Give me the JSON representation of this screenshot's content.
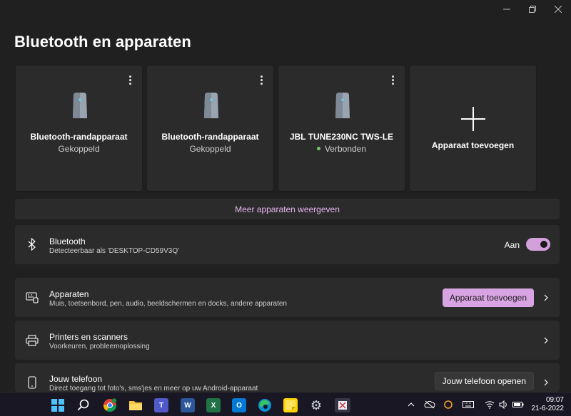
{
  "window": {
    "minimize": "—",
    "maximize": "❐",
    "close": "✕"
  },
  "page": {
    "title": "Bluetooth en apparaten"
  },
  "devices": [
    {
      "name": "Bluetooth-randapparaat",
      "status": "Gekoppeld",
      "icon": "bluetooth-device-icon"
    },
    {
      "name": "Bluetooth-randapparaat",
      "status": "Gekoppeld",
      "icon": "bluetooth-device-icon"
    },
    {
      "name": "JBL TUNE230NC TWS-LE",
      "status": "Verbonden",
      "icon": "bluetooth-device-icon"
    }
  ],
  "add_card": {
    "label": "Apparaat toevoegen"
  },
  "more_devices": {
    "label": "Meer apparaten weergeven"
  },
  "bluetooth": {
    "title": "Bluetooth",
    "subtitle": "Detecteerbaar als 'DESKTOP-CD59V3Q'",
    "toggle_label": "Aan",
    "toggle_on": true
  },
  "apparaten": {
    "title": "Apparaten",
    "subtitle": "Muis, toetsenbord, pen, audio, beeldschermen en docks, andere apparaten",
    "button": "Apparaat toevoegen"
  },
  "printers": {
    "title": "Printers en scanners",
    "subtitle": "Voorkeuren, probleemoplossing"
  },
  "phone": {
    "title": "Jouw telefoon",
    "subtitle": "Direct toegang tot foto's, sms'jes en meer op uw Android-apparaat",
    "button": "Jouw telefoon openen"
  },
  "taskbar": {
    "apps": [
      {
        "name": "start-icon",
        "glyph": ""
      },
      {
        "name": "search-icon",
        "glyph": ""
      },
      {
        "name": "chrome-icon",
        "glyph": ""
      },
      {
        "name": "file-explorer-icon",
        "glyph": ""
      },
      {
        "name": "teams-icon",
        "glyph": "T"
      },
      {
        "name": "word-icon",
        "glyph": "W"
      },
      {
        "name": "excel-icon",
        "glyph": "X"
      },
      {
        "name": "outlook-icon",
        "glyph": "O"
      },
      {
        "name": "edge-icon",
        "glyph": ""
      },
      {
        "name": "sticky-notes-icon",
        "glyph": ""
      },
      {
        "name": "settings-icon",
        "glyph": "⚙"
      },
      {
        "name": "snipping-tool-icon",
        "glyph": ""
      }
    ],
    "time": "09:07",
    "date": "21-6-2022"
  },
  "colors": {
    "accent": "#d9a4e3",
    "link": "#e7b8f0",
    "connected": "#6ccb5f",
    "background": "#202020",
    "card": "#2b2b2b"
  }
}
